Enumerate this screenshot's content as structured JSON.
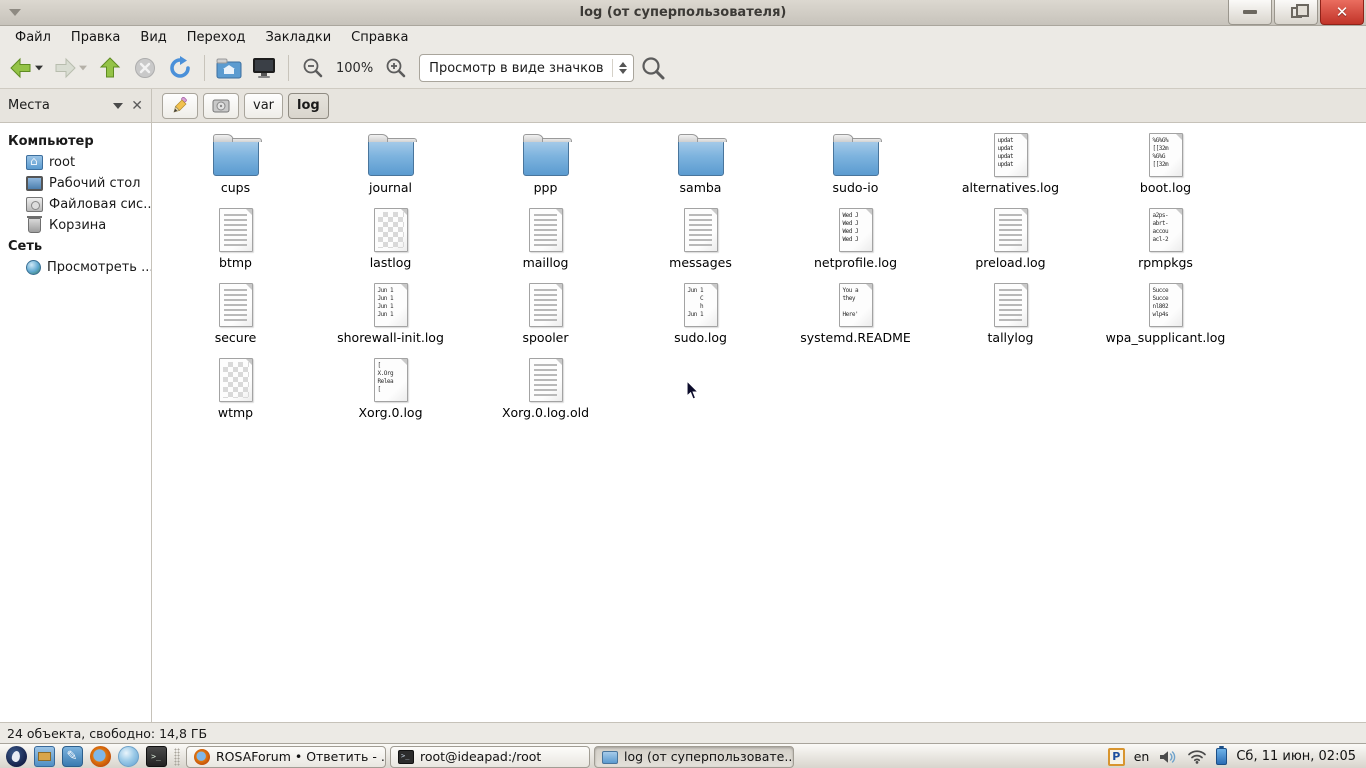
{
  "window": {
    "title": "log (от суперпользователя)",
    "menu": [
      "Файл",
      "Правка",
      "Вид",
      "Переход",
      "Закладки",
      "Справка"
    ],
    "toolbar": {
      "zoom_level": "100%",
      "view_mode": "Просмотр в виде значков"
    },
    "places_panel": {
      "title": "Места"
    },
    "pathbar": {
      "segments": [
        {
          "label": "var",
          "state": "seg-normal"
        },
        {
          "label": "log",
          "state": "seg-active"
        }
      ]
    },
    "sidebar": [
      {
        "type": "header",
        "label": "Компьютер",
        "icon": ""
      },
      {
        "type": "item",
        "label": "root",
        "icon": "home-folder-icon"
      },
      {
        "type": "item",
        "label": "Рабочий стол",
        "icon": "desktop-icon"
      },
      {
        "type": "item",
        "label": "Файловая сис...",
        "icon": "drive-icon"
      },
      {
        "type": "item",
        "label": "Корзина",
        "icon": "trash-icon"
      },
      {
        "type": "header",
        "label": "Сеть",
        "icon": ""
      },
      {
        "type": "item",
        "label": "Просмотреть ...",
        "icon": "globe-icon"
      }
    ],
    "files": [
      {
        "name": "cups",
        "kind": "folder"
      },
      {
        "name": "journal",
        "kind": "folder"
      },
      {
        "name": "ppp",
        "kind": "folder"
      },
      {
        "name": "samba",
        "kind": "folder"
      },
      {
        "name": "sudo-io",
        "kind": "folder"
      },
      {
        "name": "alternatives.log",
        "kind": "text",
        "preview": [
          "updat",
          "updat",
          "updat",
          "updat"
        ]
      },
      {
        "name": "boot.log",
        "kind": "text",
        "preview": [
          "%G%G%",
          "[[32m",
          "%G%G",
          "[[32m"
        ]
      },
      {
        "name": "btmp",
        "kind": "lines"
      },
      {
        "name": "lastlog",
        "kind": "binary"
      },
      {
        "name": "maillog",
        "kind": "lines"
      },
      {
        "name": "messages",
        "kind": "lines"
      },
      {
        "name": "netprofile.log",
        "kind": "text",
        "preview": [
          "Wed J",
          "Wed J",
          "Wed J",
          "Wed J"
        ]
      },
      {
        "name": "preload.log",
        "kind": "lines"
      },
      {
        "name": "rpmpkgs",
        "kind": "text",
        "preview": [
          "a2ps-",
          "abrt-",
          "accou",
          "acl-2"
        ]
      },
      {
        "name": "secure",
        "kind": "lines"
      },
      {
        "name": "shorewall-init.log",
        "kind": "text",
        "preview": [
          "Jun 1",
          "Jun 1",
          "Jun 1",
          "Jun 1"
        ]
      },
      {
        "name": "spooler",
        "kind": "lines"
      },
      {
        "name": "sudo.log",
        "kind": "text",
        "preview": [
          "Jun 1",
          "    C",
          "    h",
          "Jun 1"
        ]
      },
      {
        "name": "systemd.README",
        "kind": "text",
        "preview": [
          "You a",
          "they",
          "",
          "Here'"
        ]
      },
      {
        "name": "tallylog",
        "kind": "lines"
      },
      {
        "name": "wpa_supplicant.log",
        "kind": "text",
        "preview": [
          "Succe",
          "Succe",
          "nl802",
          "wlp4s"
        ]
      },
      {
        "name": "wtmp",
        "kind": "binary"
      },
      {
        "name": "Xorg.0.log",
        "kind": "text",
        "preview": [
          "[",
          "X.Org",
          "Relea",
          "["
        ]
      },
      {
        "name": "Xorg.0.log.old",
        "kind": "lines"
      }
    ],
    "statusbar": {
      "text": "24 объекта, свободно: 14,8 ГБ"
    }
  },
  "taskbar": {
    "launchers": [
      {
        "icon": "rosa-menu-icon"
      },
      {
        "icon": "file-manager-icon"
      },
      {
        "icon": "text-editor-icon"
      },
      {
        "icon": "firefox-icon"
      },
      {
        "icon": "media-player-icon"
      },
      {
        "icon": "terminal-icon"
      }
    ],
    "tasks": [
      {
        "icon": "firefox-icon",
        "label": "ROSAForum • Ответить - ...",
        "state": "normal"
      },
      {
        "icon": "terminal-icon",
        "label": "root@ideapad:/root",
        "state": "normal"
      },
      {
        "icon": "folder-icon",
        "label": "log (от суперпользовате...",
        "state": "active"
      }
    ],
    "tray": {
      "keyboard_layout": "en",
      "clock": "Сб, 11 июн, 02:05"
    }
  },
  "colors": {
    "folder_blue": "#5b9bd0",
    "close_red": "#c13429",
    "chrome_gray": "#eceae5",
    "battery_blue": "#2b6db5"
  }
}
